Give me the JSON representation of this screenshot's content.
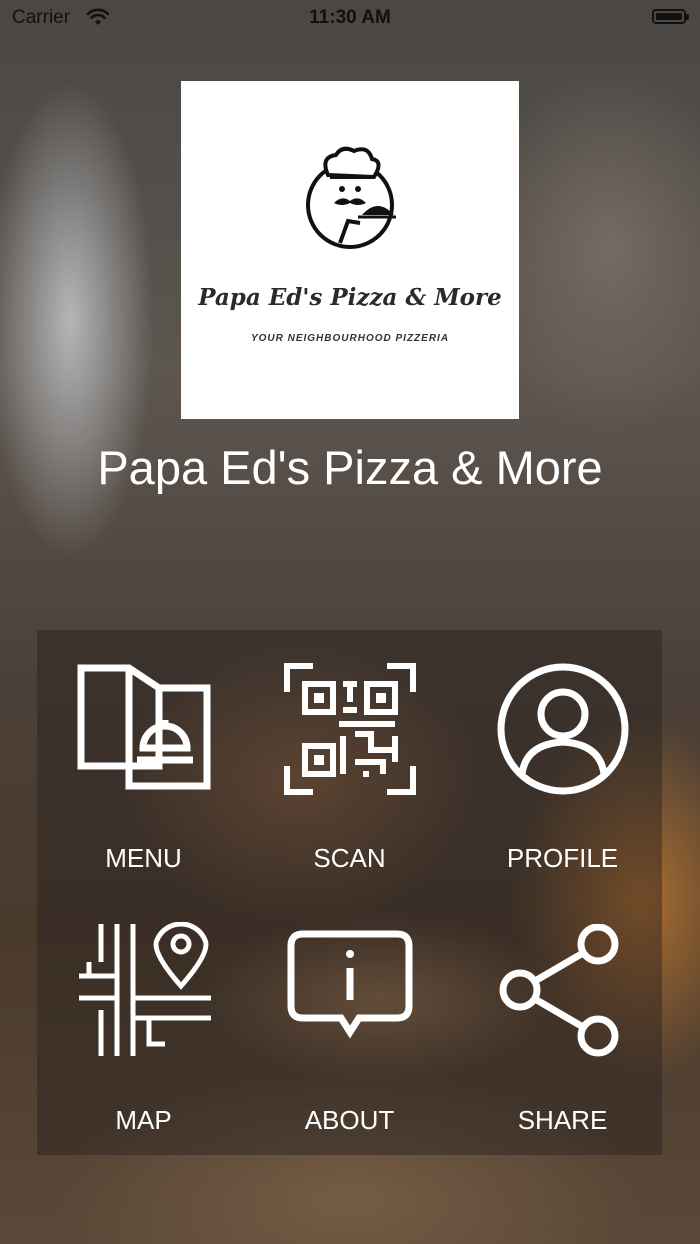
{
  "status_bar": {
    "carrier": "Carrier",
    "time": "11:30 AM"
  },
  "logo": {
    "name": "Papa Ed's Pizza & More",
    "tagline": "YOUR NEIGHBOURHOOD PIZZERIA"
  },
  "app_title": "Papa Ed's Pizza & More",
  "tiles": [
    {
      "label": "MENU",
      "icon": "menu-icon"
    },
    {
      "label": "SCAN",
      "icon": "qr-code-icon"
    },
    {
      "label": "PROFILE",
      "icon": "profile-icon"
    },
    {
      "label": "MAP",
      "icon": "map-pin-icon"
    },
    {
      "label": "ABOUT",
      "icon": "info-icon"
    },
    {
      "label": "SHARE",
      "icon": "share-icon"
    }
  ]
}
